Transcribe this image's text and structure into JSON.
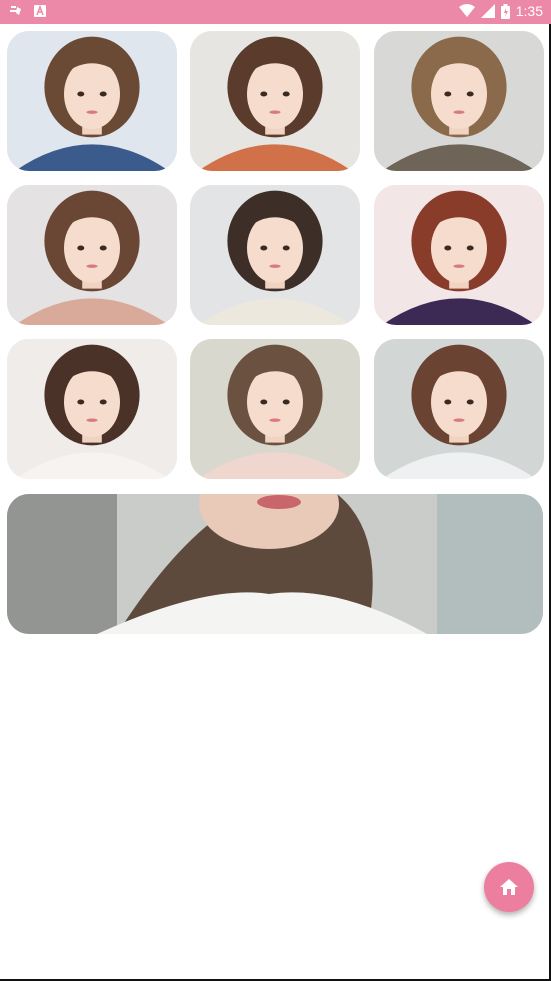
{
  "status_bar": {
    "time": "1:35",
    "background": "#ec89a8",
    "icons": [
      "notification-app-icon",
      "a-badge-icon",
      "wifi-icon",
      "cellular-signal-icon",
      "battery-icon"
    ]
  },
  "gallery": {
    "items": [
      {
        "name": "hairstyle-photo-1",
        "bg": "#dfe6ee",
        "hair": "#6b4a35",
        "shirt": "#3a5b8c"
      },
      {
        "name": "hairstyle-photo-2",
        "bg": "#e7e5e2",
        "hair": "#5a3b2c",
        "shirt": "#d0714a"
      },
      {
        "name": "hairstyle-photo-3",
        "bg": "#d8d8d6",
        "hair": "#8a6a4a",
        "shirt": "#6f6458"
      },
      {
        "name": "hairstyle-photo-4",
        "bg": "#e4e2e3",
        "hair": "#6a4734",
        "shirt": "#d9aa9a"
      },
      {
        "name": "hairstyle-photo-5",
        "bg": "#e2e4e6",
        "hair": "#3d2e27",
        "shirt": "#ede8dd"
      },
      {
        "name": "hairstyle-photo-6",
        "bg": "#f2e6e6",
        "hair": "#8a3c2a",
        "shirt": "#3c2a54"
      },
      {
        "name": "hairstyle-photo-7",
        "bg": "#efece9",
        "hair": "#4a3228",
        "shirt": "#f6f3f0"
      },
      {
        "name": "hairstyle-photo-8",
        "bg": "#d9d8cf",
        "hair": "#6b5140",
        "shirt": "#efd7cf"
      },
      {
        "name": "hairstyle-photo-9",
        "bg": "#d2d7d6",
        "hair": "#6a4332",
        "shirt": "#eef0f2"
      }
    ],
    "banner": {
      "name": "hairstyle-banner-photo",
      "bg": "#c9ccc8",
      "hair": "#5e4a3c",
      "shirt": "#f4f4f2"
    }
  },
  "fab": {
    "icon": "home-icon",
    "color": "#ec7f9f"
  }
}
